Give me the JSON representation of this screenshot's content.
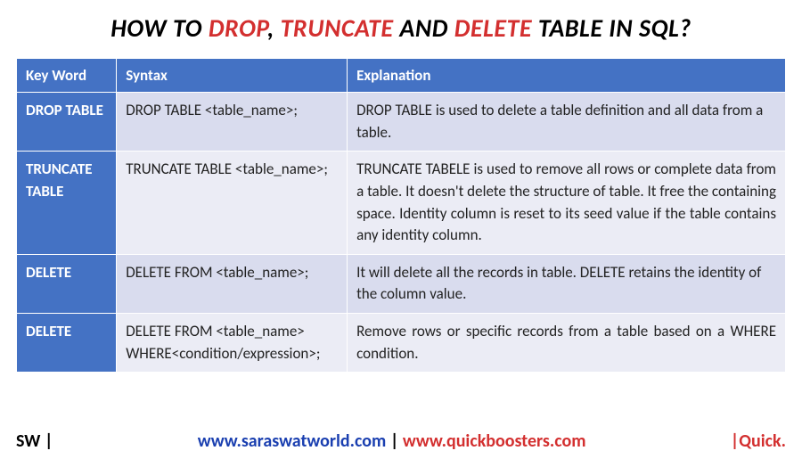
{
  "heading": {
    "p1": "HOW TO ",
    "w1": "DROP",
    "p2": ", ",
    "w2": "TRUNCATE",
    "p3": " AND ",
    "w3": "DELETE",
    "p4": " TABLE IN SQL?"
  },
  "table": {
    "headers": {
      "c1": "Key Word",
      "c2": "Syntax",
      "c3": "Explanation"
    },
    "rows": [
      {
        "key": "DROP TABLE",
        "syntax": "DROP TABLE <table_name>;",
        "expl": "DROP TABLE is used to delete a table definition and all data from a table."
      },
      {
        "key": "TRUNCATE TABLE",
        "syntax": "TRUNCATE TABLE <table_name>;",
        "expl": "TRUNCATE TABELE is used to remove all rows or complete data from a table. It doesn't delete the structure of table. It free the containing space. Identity column is reset to its seed value if the table contains any identity column."
      },
      {
        "key": "DELETE",
        "syntax": "DELETE FROM <table_name>;",
        "expl": "It will delete all the records in table. DELETE retains the identity of the column value."
      },
      {
        "key": "DELETE",
        "syntax": "DELETE FROM <table_name> WHERE<condition/expression>;",
        "expl": "Remove rows or specific records from a table based on a WHERE condition."
      }
    ]
  },
  "footer": {
    "left": "SW |",
    "url1": "www.saraswatworld.com",
    "sep": " | ",
    "url2": "www.quickboosters.com",
    "rightBar": "|",
    "rightText": "Quick."
  }
}
